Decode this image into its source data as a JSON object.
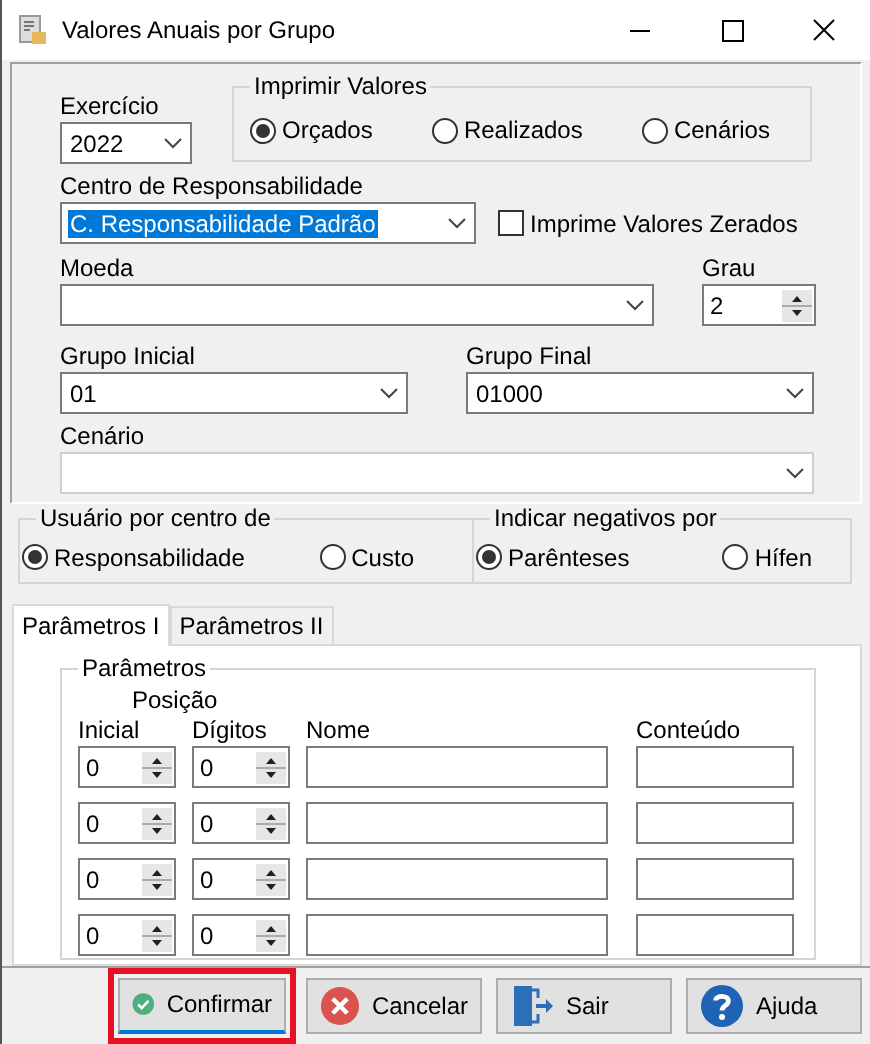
{
  "window": {
    "title": "Valores Anuais por Grupo"
  },
  "exercicio": {
    "label": "Exercício",
    "value": "2022"
  },
  "imprimir_valores": {
    "title": "Imprimir Valores",
    "options": [
      {
        "label": "Orçados",
        "selected": true
      },
      {
        "label": "Realizados",
        "selected": false
      },
      {
        "label": "Cenários",
        "selected": false
      }
    ]
  },
  "centro": {
    "label": "Centro de Responsabilidade",
    "value": "C. Responsabilidade Padrão",
    "text_selected": true
  },
  "imprime_zerados": {
    "label": "Imprime Valores Zerados",
    "checked": false
  },
  "moeda": {
    "label": "Moeda"
  },
  "grau": {
    "label": "Grau",
    "value": "2"
  },
  "grupo_inicial": {
    "label": "Grupo Inicial",
    "value": "01"
  },
  "grupo_final": {
    "label": "Grupo Final",
    "value": "01000"
  },
  "cenario": {
    "label": "Cenário",
    "disabled": true
  },
  "usuario_por": {
    "title": "Usuário por centro de",
    "options": [
      {
        "label": "Responsabilidade",
        "selected": true
      },
      {
        "label": "Custo",
        "selected": false
      }
    ]
  },
  "negativos": {
    "title": "Indicar negativos por",
    "options": [
      {
        "label": "Parênteses",
        "selected": true
      },
      {
        "label": "Hífen",
        "selected": false
      }
    ]
  },
  "tabs": [
    {
      "label": "Parâmetros I",
      "selected": true
    },
    {
      "label": "Parâmetros II",
      "selected": false
    }
  ],
  "parametros": {
    "title": "Parâmetros",
    "group_header": "Posição",
    "columns": [
      "Inicial",
      "Dígitos",
      "Nome",
      "Conteúdo"
    ],
    "rows": [
      {
        "inicial": "0",
        "digitos": "0"
      },
      {
        "inicial": "0",
        "digitos": "0"
      },
      {
        "inicial": "0",
        "digitos": "0"
      },
      {
        "inicial": "0",
        "digitos": "0"
      }
    ]
  },
  "buttons": [
    {
      "label": "Confirmar",
      "kind": "confirm",
      "highlighted": true
    },
    {
      "label": "Cancelar",
      "kind": "cancel",
      "highlighted": false
    },
    {
      "label": "Sair",
      "kind": "exit",
      "highlighted": false
    },
    {
      "label": "Ajuda",
      "kind": "help",
      "highlighted": false
    }
  ]
}
